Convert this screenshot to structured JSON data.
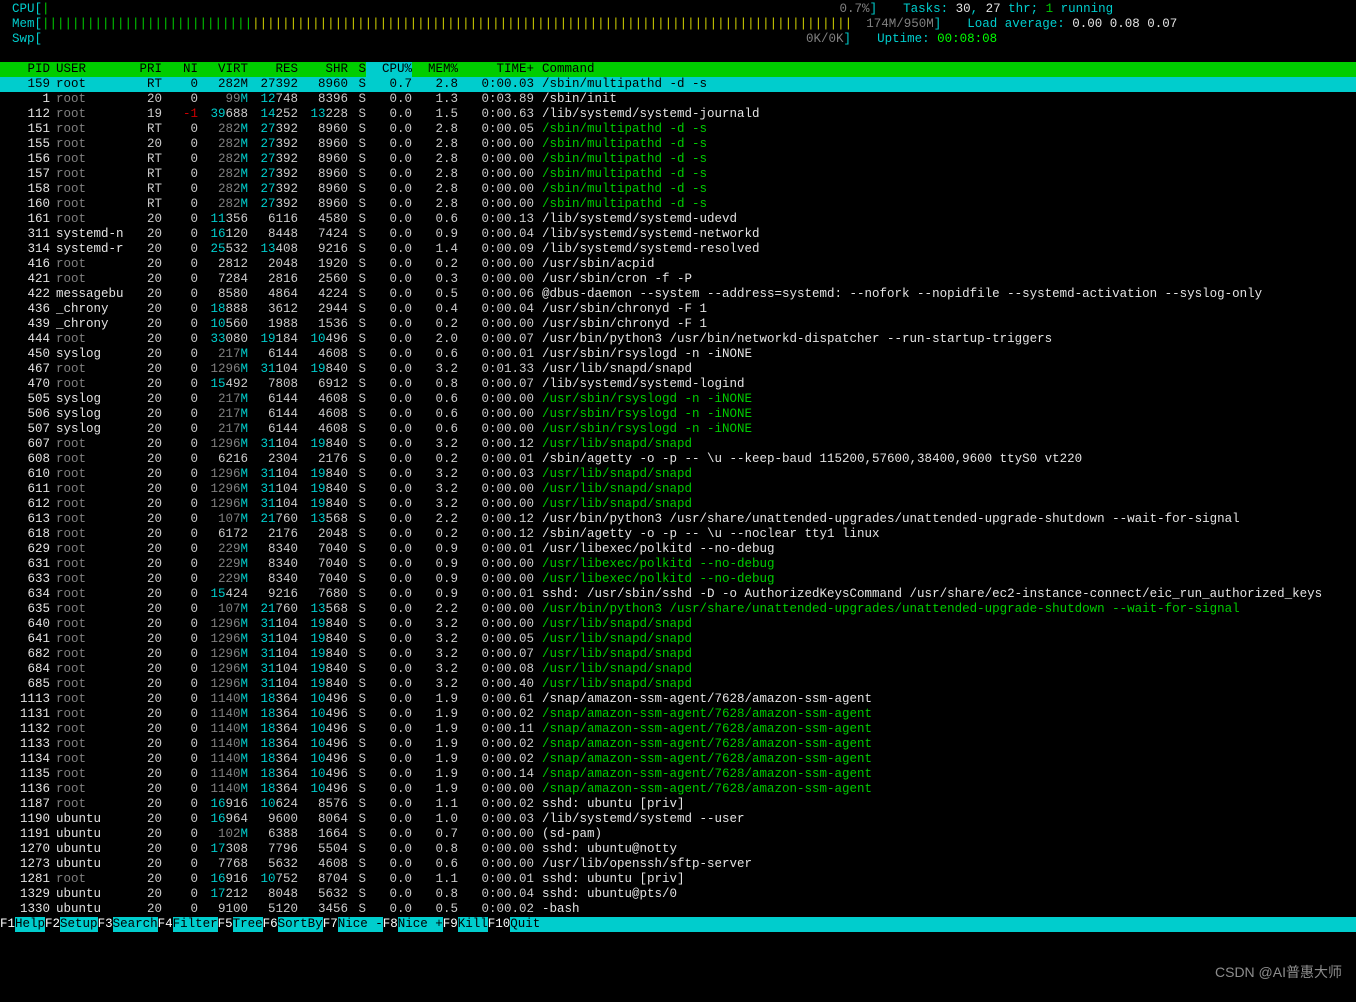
{
  "meters": {
    "cpu": {
      "label": "CPU",
      "bar_on": "|",
      "bar_fill": "",
      "value": "0.7%",
      "close": "]"
    },
    "mem": {
      "label": "Mem",
      "bar": "||||||||||||||||||",
      "value": "174M/950M",
      "close": "]"
    },
    "swp": {
      "label": "Swp",
      "bar": "",
      "value": "0K/0K",
      "close": "]"
    }
  },
  "summary": {
    "tasks_label": "Tasks: ",
    "tasks": "30",
    "tasks_sep": ", ",
    "thr": "27",
    "thr_label": " thr; ",
    "running": "1",
    "running_label": " running",
    "load_label": "Load average: ",
    "load": "0.00 0.08 0.07",
    "uptime_label": "Uptime: ",
    "uptime": "00:08:08"
  },
  "header": {
    "pid": "PID",
    "user": "USER",
    "pri": "PRI",
    "ni": "NI",
    "virt": "VIRT",
    "res": "RES",
    "shr": "SHR",
    "s": "S",
    "cpu": "CPU%",
    "mem": "MEM%",
    "time": "TIME+",
    "cmd": "Command"
  },
  "selected_index": 0,
  "processes": [
    {
      "pid": "159",
      "user": "root",
      "pri": "RT",
      "ni": "0",
      "virt": "282M",
      "res": "27392",
      "shr": "8960",
      "s": "S",
      "cpu": "0.7",
      "mem": "2.8",
      "time": "0:00.03",
      "cmd": "/sbin/multipathd -d -s",
      "cmd_hl": false
    },
    {
      "pid": "1",
      "user": "root",
      "pri": "20",
      "ni": "0",
      "virt": "99M",
      "res": "12748",
      "shr": "8396",
      "s": "S",
      "cpu": "0.0",
      "mem": "1.3",
      "time": "0:03.89",
      "cmd": "/sbin/init",
      "cmd_hl": false
    },
    {
      "pid": "112",
      "user": "root",
      "pri": "19",
      "ni": "-1",
      "virt": "39688",
      "res": "14252",
      "shr": "13228",
      "s": "S",
      "cpu": "0.0",
      "mem": "1.5",
      "time": "0:00.63",
      "cmd": "/lib/systemd/systemd-journald",
      "cmd_hl": false
    },
    {
      "pid": "151",
      "user": "root",
      "pri": "RT",
      "ni": "0",
      "virt": "282M",
      "res": "27392",
      "shr": "8960",
      "s": "S",
      "cpu": "0.0",
      "mem": "2.8",
      "time": "0:00.05",
      "cmd": "/sbin/multipathd -d -s",
      "cmd_hl": true
    },
    {
      "pid": "155",
      "user": "root",
      "pri": "20",
      "ni": "0",
      "virt": "282M",
      "res": "27392",
      "shr": "8960",
      "s": "S",
      "cpu": "0.0",
      "mem": "2.8",
      "time": "0:00.00",
      "cmd": "/sbin/multipathd -d -s",
      "cmd_hl": true
    },
    {
      "pid": "156",
      "user": "root",
      "pri": "RT",
      "ni": "0",
      "virt": "282M",
      "res": "27392",
      "shr": "8960",
      "s": "S",
      "cpu": "0.0",
      "mem": "2.8",
      "time": "0:00.00",
      "cmd": "/sbin/multipathd -d -s",
      "cmd_hl": true
    },
    {
      "pid": "157",
      "user": "root",
      "pri": "RT",
      "ni": "0",
      "virt": "282M",
      "res": "27392",
      "shr": "8960",
      "s": "S",
      "cpu": "0.0",
      "mem": "2.8",
      "time": "0:00.00",
      "cmd": "/sbin/multipathd -d -s",
      "cmd_hl": true
    },
    {
      "pid": "158",
      "user": "root",
      "pri": "RT",
      "ni": "0",
      "virt": "282M",
      "res": "27392",
      "shr": "8960",
      "s": "S",
      "cpu": "0.0",
      "mem": "2.8",
      "time": "0:00.00",
      "cmd": "/sbin/multipathd -d -s",
      "cmd_hl": true
    },
    {
      "pid": "160",
      "user": "root",
      "pri": "RT",
      "ni": "0",
      "virt": "282M",
      "res": "27392",
      "shr": "8960",
      "s": "S",
      "cpu": "0.0",
      "mem": "2.8",
      "time": "0:00.00",
      "cmd": "/sbin/multipathd -d -s",
      "cmd_hl": true
    },
    {
      "pid": "161",
      "user": "root",
      "pri": "20",
      "ni": "0",
      "virt": "11356",
      "res": "6116",
      "shr": "4580",
      "s": "S",
      "cpu": "0.0",
      "mem": "0.6",
      "time": "0:00.13",
      "cmd": "/lib/systemd/systemd-udevd",
      "cmd_hl": false
    },
    {
      "pid": "311",
      "user": "systemd-n",
      "pri": "20",
      "ni": "0",
      "virt": "16120",
      "res": "8448",
      "shr": "7424",
      "s": "S",
      "cpu": "0.0",
      "mem": "0.9",
      "time": "0:00.04",
      "cmd": "/lib/systemd/systemd-networkd",
      "cmd_hl": false
    },
    {
      "pid": "314",
      "user": "systemd-r",
      "pri": "20",
      "ni": "0",
      "virt": "25532",
      "res": "13408",
      "shr": "9216",
      "s": "S",
      "cpu": "0.0",
      "mem": "1.4",
      "time": "0:00.09",
      "cmd": "/lib/systemd/systemd-resolved",
      "cmd_hl": false
    },
    {
      "pid": "416",
      "user": "root",
      "pri": "20",
      "ni": "0",
      "virt": "2812",
      "res": "2048",
      "shr": "1920",
      "s": "S",
      "cpu": "0.0",
      "mem": "0.2",
      "time": "0:00.00",
      "cmd": "/usr/sbin/acpid",
      "cmd_hl": false
    },
    {
      "pid": "421",
      "user": "root",
      "pri": "20",
      "ni": "0",
      "virt": "7284",
      "res": "2816",
      "shr": "2560",
      "s": "S",
      "cpu": "0.0",
      "mem": "0.3",
      "time": "0:00.00",
      "cmd": "/usr/sbin/cron -f -P",
      "cmd_hl": false
    },
    {
      "pid": "422",
      "user": "messagebu",
      "pri": "20",
      "ni": "0",
      "virt": "8580",
      "res": "4864",
      "shr": "4224",
      "s": "S",
      "cpu": "0.0",
      "mem": "0.5",
      "time": "0:00.06",
      "cmd": "@dbus-daemon --system --address=systemd: --nofork --nopidfile --systemd-activation --syslog-only",
      "cmd_hl": false
    },
    {
      "pid": "436",
      "user": "_chrony",
      "pri": "20",
      "ni": "0",
      "virt": "18888",
      "res": "3612",
      "shr": "2944",
      "s": "S",
      "cpu": "0.0",
      "mem": "0.4",
      "time": "0:00.04",
      "cmd": "/usr/sbin/chronyd -F 1",
      "cmd_hl": false
    },
    {
      "pid": "439",
      "user": "_chrony",
      "pri": "20",
      "ni": "0",
      "virt": "10560",
      "res": "1988",
      "shr": "1536",
      "s": "S",
      "cpu": "0.0",
      "mem": "0.2",
      "time": "0:00.00",
      "cmd": "/usr/sbin/chronyd -F 1",
      "cmd_hl": false
    },
    {
      "pid": "444",
      "user": "root",
      "pri": "20",
      "ni": "0",
      "virt": "33080",
      "res": "19184",
      "shr": "10496",
      "s": "S",
      "cpu": "0.0",
      "mem": "2.0",
      "time": "0:00.07",
      "cmd": "/usr/bin/python3 /usr/bin/networkd-dispatcher --run-startup-triggers",
      "cmd_hl": false
    },
    {
      "pid": "450",
      "user": "syslog",
      "pri": "20",
      "ni": "0",
      "virt": "217M",
      "res": "6144",
      "shr": "4608",
      "s": "S",
      "cpu": "0.0",
      "mem": "0.6",
      "time": "0:00.01",
      "cmd": "/usr/sbin/rsyslogd -n -iNONE",
      "cmd_hl": false
    },
    {
      "pid": "467",
      "user": "root",
      "pri": "20",
      "ni": "0",
      "virt": "1296M",
      "res": "31104",
      "shr": "19840",
      "s": "S",
      "cpu": "0.0",
      "mem": "3.2",
      "time": "0:01.33",
      "cmd": "/usr/lib/snapd/snapd",
      "cmd_hl": false
    },
    {
      "pid": "470",
      "user": "root",
      "pri": "20",
      "ni": "0",
      "virt": "15492",
      "res": "7808",
      "shr": "6912",
      "s": "S",
      "cpu": "0.0",
      "mem": "0.8",
      "time": "0:00.07",
      "cmd": "/lib/systemd/systemd-logind",
      "cmd_hl": false
    },
    {
      "pid": "505",
      "user": "syslog",
      "pri": "20",
      "ni": "0",
      "virt": "217M",
      "res": "6144",
      "shr": "4608",
      "s": "S",
      "cpu": "0.0",
      "mem": "0.6",
      "time": "0:00.00",
      "cmd": "/usr/sbin/rsyslogd -n -iNONE",
      "cmd_hl": true
    },
    {
      "pid": "506",
      "user": "syslog",
      "pri": "20",
      "ni": "0",
      "virt": "217M",
      "res": "6144",
      "shr": "4608",
      "s": "S",
      "cpu": "0.0",
      "mem": "0.6",
      "time": "0:00.00",
      "cmd": "/usr/sbin/rsyslogd -n -iNONE",
      "cmd_hl": true
    },
    {
      "pid": "507",
      "user": "syslog",
      "pri": "20",
      "ni": "0",
      "virt": "217M",
      "res": "6144",
      "shr": "4608",
      "s": "S",
      "cpu": "0.0",
      "mem": "0.6",
      "time": "0:00.00",
      "cmd": "/usr/sbin/rsyslogd -n -iNONE",
      "cmd_hl": true
    },
    {
      "pid": "607",
      "user": "root",
      "pri": "20",
      "ni": "0",
      "virt": "1296M",
      "res": "31104",
      "shr": "19840",
      "s": "S",
      "cpu": "0.0",
      "mem": "3.2",
      "time": "0:00.12",
      "cmd": "/usr/lib/snapd/snapd",
      "cmd_hl": true
    },
    {
      "pid": "608",
      "user": "root",
      "pri": "20",
      "ni": "0",
      "virt": "6216",
      "res": "2304",
      "shr": "2176",
      "s": "S",
      "cpu": "0.0",
      "mem": "0.2",
      "time": "0:00.01",
      "cmd": "/sbin/agetty -o -p -- \\u --keep-baud 115200,57600,38400,9600 ttyS0 vt220",
      "cmd_hl": false
    },
    {
      "pid": "610",
      "user": "root",
      "pri": "20",
      "ni": "0",
      "virt": "1296M",
      "res": "31104",
      "shr": "19840",
      "s": "S",
      "cpu": "0.0",
      "mem": "3.2",
      "time": "0:00.03",
      "cmd": "/usr/lib/snapd/snapd",
      "cmd_hl": true
    },
    {
      "pid": "611",
      "user": "root",
      "pri": "20",
      "ni": "0",
      "virt": "1296M",
      "res": "31104",
      "shr": "19840",
      "s": "S",
      "cpu": "0.0",
      "mem": "3.2",
      "time": "0:00.00",
      "cmd": "/usr/lib/snapd/snapd",
      "cmd_hl": true
    },
    {
      "pid": "612",
      "user": "root",
      "pri": "20",
      "ni": "0",
      "virt": "1296M",
      "res": "31104",
      "shr": "19840",
      "s": "S",
      "cpu": "0.0",
      "mem": "3.2",
      "time": "0:00.00",
      "cmd": "/usr/lib/snapd/snapd",
      "cmd_hl": true
    },
    {
      "pid": "613",
      "user": "root",
      "pri": "20",
      "ni": "0",
      "virt": "107M",
      "res": "21760",
      "shr": "13568",
      "s": "S",
      "cpu": "0.0",
      "mem": "2.2",
      "time": "0:00.12",
      "cmd": "/usr/bin/python3 /usr/share/unattended-upgrades/unattended-upgrade-shutdown --wait-for-signal",
      "cmd_hl": false
    },
    {
      "pid": "618",
      "user": "root",
      "pri": "20",
      "ni": "0",
      "virt": "6172",
      "res": "2176",
      "shr": "2048",
      "s": "S",
      "cpu": "0.0",
      "mem": "0.2",
      "time": "0:00.12",
      "cmd": "/sbin/agetty -o -p -- \\u --noclear tty1 linux",
      "cmd_hl": false
    },
    {
      "pid": "629",
      "user": "root",
      "pri": "20",
      "ni": "0",
      "virt": "229M",
      "res": "8340",
      "shr": "7040",
      "s": "S",
      "cpu": "0.0",
      "mem": "0.9",
      "time": "0:00.01",
      "cmd": "/usr/libexec/polkitd --no-debug",
      "cmd_hl": false
    },
    {
      "pid": "631",
      "user": "root",
      "pri": "20",
      "ni": "0",
      "virt": "229M",
      "res": "8340",
      "shr": "7040",
      "s": "S",
      "cpu": "0.0",
      "mem": "0.9",
      "time": "0:00.00",
      "cmd": "/usr/libexec/polkitd --no-debug",
      "cmd_hl": true
    },
    {
      "pid": "633",
      "user": "root",
      "pri": "20",
      "ni": "0",
      "virt": "229M",
      "res": "8340",
      "shr": "7040",
      "s": "S",
      "cpu": "0.0",
      "mem": "0.9",
      "time": "0:00.00",
      "cmd": "/usr/libexec/polkitd --no-debug",
      "cmd_hl": true
    },
    {
      "pid": "634",
      "user": "root",
      "pri": "20",
      "ni": "0",
      "virt": "15424",
      "res": "9216",
      "shr": "7680",
      "s": "S",
      "cpu": "0.0",
      "mem": "0.9",
      "time": "0:00.01",
      "cmd": "sshd: /usr/sbin/sshd -D -o AuthorizedKeysCommand /usr/share/ec2-instance-connect/eic_run_authorized_keys",
      "cmd_hl": false
    },
    {
      "pid": "635",
      "user": "root",
      "pri": "20",
      "ni": "0",
      "virt": "107M",
      "res": "21760",
      "shr": "13568",
      "s": "S",
      "cpu": "0.0",
      "mem": "2.2",
      "time": "0:00.00",
      "cmd": "/usr/bin/python3 /usr/share/unattended-upgrades/unattended-upgrade-shutdown --wait-for-signal",
      "cmd_hl": true
    },
    {
      "pid": "640",
      "user": "root",
      "pri": "20",
      "ni": "0",
      "virt": "1296M",
      "res": "31104",
      "shr": "19840",
      "s": "S",
      "cpu": "0.0",
      "mem": "3.2",
      "time": "0:00.00",
      "cmd": "/usr/lib/snapd/snapd",
      "cmd_hl": true
    },
    {
      "pid": "641",
      "user": "root",
      "pri": "20",
      "ni": "0",
      "virt": "1296M",
      "res": "31104",
      "shr": "19840",
      "s": "S",
      "cpu": "0.0",
      "mem": "3.2",
      "time": "0:00.05",
      "cmd": "/usr/lib/snapd/snapd",
      "cmd_hl": true
    },
    {
      "pid": "682",
      "user": "root",
      "pri": "20",
      "ni": "0",
      "virt": "1296M",
      "res": "31104",
      "shr": "19840",
      "s": "S",
      "cpu": "0.0",
      "mem": "3.2",
      "time": "0:00.07",
      "cmd": "/usr/lib/snapd/snapd",
      "cmd_hl": true
    },
    {
      "pid": "684",
      "user": "root",
      "pri": "20",
      "ni": "0",
      "virt": "1296M",
      "res": "31104",
      "shr": "19840",
      "s": "S",
      "cpu": "0.0",
      "mem": "3.2",
      "time": "0:00.08",
      "cmd": "/usr/lib/snapd/snapd",
      "cmd_hl": true
    },
    {
      "pid": "685",
      "user": "root",
      "pri": "20",
      "ni": "0",
      "virt": "1296M",
      "res": "31104",
      "shr": "19840",
      "s": "S",
      "cpu": "0.0",
      "mem": "3.2",
      "time": "0:00.40",
      "cmd": "/usr/lib/snapd/snapd",
      "cmd_hl": true
    },
    {
      "pid": "1113",
      "user": "root",
      "pri": "20",
      "ni": "0",
      "virt": "1140M",
      "res": "18364",
      "shr": "10496",
      "s": "S",
      "cpu": "0.0",
      "mem": "1.9",
      "time": "0:00.61",
      "cmd": "/snap/amazon-ssm-agent/7628/amazon-ssm-agent",
      "cmd_hl": false
    },
    {
      "pid": "1131",
      "user": "root",
      "pri": "20",
      "ni": "0",
      "virt": "1140M",
      "res": "18364",
      "shr": "10496",
      "s": "S",
      "cpu": "0.0",
      "mem": "1.9",
      "time": "0:00.02",
      "cmd": "/snap/amazon-ssm-agent/7628/amazon-ssm-agent",
      "cmd_hl": true
    },
    {
      "pid": "1132",
      "user": "root",
      "pri": "20",
      "ni": "0",
      "virt": "1140M",
      "res": "18364",
      "shr": "10496",
      "s": "S",
      "cpu": "0.0",
      "mem": "1.9",
      "time": "0:00.11",
      "cmd": "/snap/amazon-ssm-agent/7628/amazon-ssm-agent",
      "cmd_hl": true
    },
    {
      "pid": "1133",
      "user": "root",
      "pri": "20",
      "ni": "0",
      "virt": "1140M",
      "res": "18364",
      "shr": "10496",
      "s": "S",
      "cpu": "0.0",
      "mem": "1.9",
      "time": "0:00.02",
      "cmd": "/snap/amazon-ssm-agent/7628/amazon-ssm-agent",
      "cmd_hl": true
    },
    {
      "pid": "1134",
      "user": "root",
      "pri": "20",
      "ni": "0",
      "virt": "1140M",
      "res": "18364",
      "shr": "10496",
      "s": "S",
      "cpu": "0.0",
      "mem": "1.9",
      "time": "0:00.02",
      "cmd": "/snap/amazon-ssm-agent/7628/amazon-ssm-agent",
      "cmd_hl": true
    },
    {
      "pid": "1135",
      "user": "root",
      "pri": "20",
      "ni": "0",
      "virt": "1140M",
      "res": "18364",
      "shr": "10496",
      "s": "S",
      "cpu": "0.0",
      "mem": "1.9",
      "time": "0:00.14",
      "cmd": "/snap/amazon-ssm-agent/7628/amazon-ssm-agent",
      "cmd_hl": true
    },
    {
      "pid": "1136",
      "user": "root",
      "pri": "20",
      "ni": "0",
      "virt": "1140M",
      "res": "18364",
      "shr": "10496",
      "s": "S",
      "cpu": "0.0",
      "mem": "1.9",
      "time": "0:00.00",
      "cmd": "/snap/amazon-ssm-agent/7628/amazon-ssm-agent",
      "cmd_hl": true
    },
    {
      "pid": "1187",
      "user": "root",
      "pri": "20",
      "ni": "0",
      "virt": "16916",
      "res": "10624",
      "shr": "8576",
      "s": "S",
      "cpu": "0.0",
      "mem": "1.1",
      "time": "0:00.02",
      "cmd": "sshd: ubuntu [priv]",
      "cmd_hl": false
    },
    {
      "pid": "1190",
      "user": "ubuntu",
      "pri": "20",
      "ni": "0",
      "virt": "16964",
      "res": "9600",
      "shr": "8064",
      "s": "S",
      "cpu": "0.0",
      "mem": "1.0",
      "time": "0:00.03",
      "cmd": "/lib/systemd/systemd --user",
      "cmd_hl": false
    },
    {
      "pid": "1191",
      "user": "ubuntu",
      "pri": "20",
      "ni": "0",
      "virt": "102M",
      "res": "6388",
      "shr": "1664",
      "s": "S",
      "cpu": "0.0",
      "mem": "0.7",
      "time": "0:00.00",
      "cmd": "(sd-pam)",
      "cmd_hl": false
    },
    {
      "pid": "1270",
      "user": "ubuntu",
      "pri": "20",
      "ni": "0",
      "virt": "17308",
      "res": "7796",
      "shr": "5504",
      "s": "S",
      "cpu": "0.0",
      "mem": "0.8",
      "time": "0:00.00",
      "cmd": "sshd: ubuntu@notty",
      "cmd_hl": false
    },
    {
      "pid": "1273",
      "user": "ubuntu",
      "pri": "20",
      "ni": "0",
      "virt": "7768",
      "res": "5632",
      "shr": "4608",
      "s": "S",
      "cpu": "0.0",
      "mem": "0.6",
      "time": "0:00.00",
      "cmd": "/usr/lib/openssh/sftp-server",
      "cmd_hl": false
    },
    {
      "pid": "1281",
      "user": "root",
      "pri": "20",
      "ni": "0",
      "virt": "16916",
      "res": "10752",
      "shr": "8704",
      "s": "S",
      "cpu": "0.0",
      "mem": "1.1",
      "time": "0:00.01",
      "cmd": "sshd: ubuntu [priv]",
      "cmd_hl": false
    },
    {
      "pid": "1329",
      "user": "ubuntu",
      "pri": "20",
      "ni": "0",
      "virt": "17212",
      "res": "8048",
      "shr": "5632",
      "s": "S",
      "cpu": "0.0",
      "mem": "0.8",
      "time": "0:00.04",
      "cmd": "sshd: ubuntu@pts/0",
      "cmd_hl": false
    },
    {
      "pid": "1330",
      "user": "ubuntu",
      "pri": "20",
      "ni": "0",
      "virt": "9100",
      "res": "5120",
      "shr": "3456",
      "s": "S",
      "cpu": "0.0",
      "mem": "0.5",
      "time": "0:00.02",
      "cmd": "-bash",
      "cmd_hl": false
    }
  ],
  "footer": [
    {
      "key": "F1",
      "label": "Help  "
    },
    {
      "key": "F2",
      "label": "Setup "
    },
    {
      "key": "F3",
      "label": "Search"
    },
    {
      "key": "F4",
      "label": "Filter"
    },
    {
      "key": "F5",
      "label": "Tree  "
    },
    {
      "key": "F6",
      "label": "SortBy"
    },
    {
      "key": "F7",
      "label": "Nice -"
    },
    {
      "key": "F8",
      "label": "Nice +"
    },
    {
      "key": "F9",
      "label": "Kill  "
    },
    {
      "key": "F10",
      "label": "Quit  "
    }
  ],
  "watermark": "CSDN @AI普惠大师"
}
